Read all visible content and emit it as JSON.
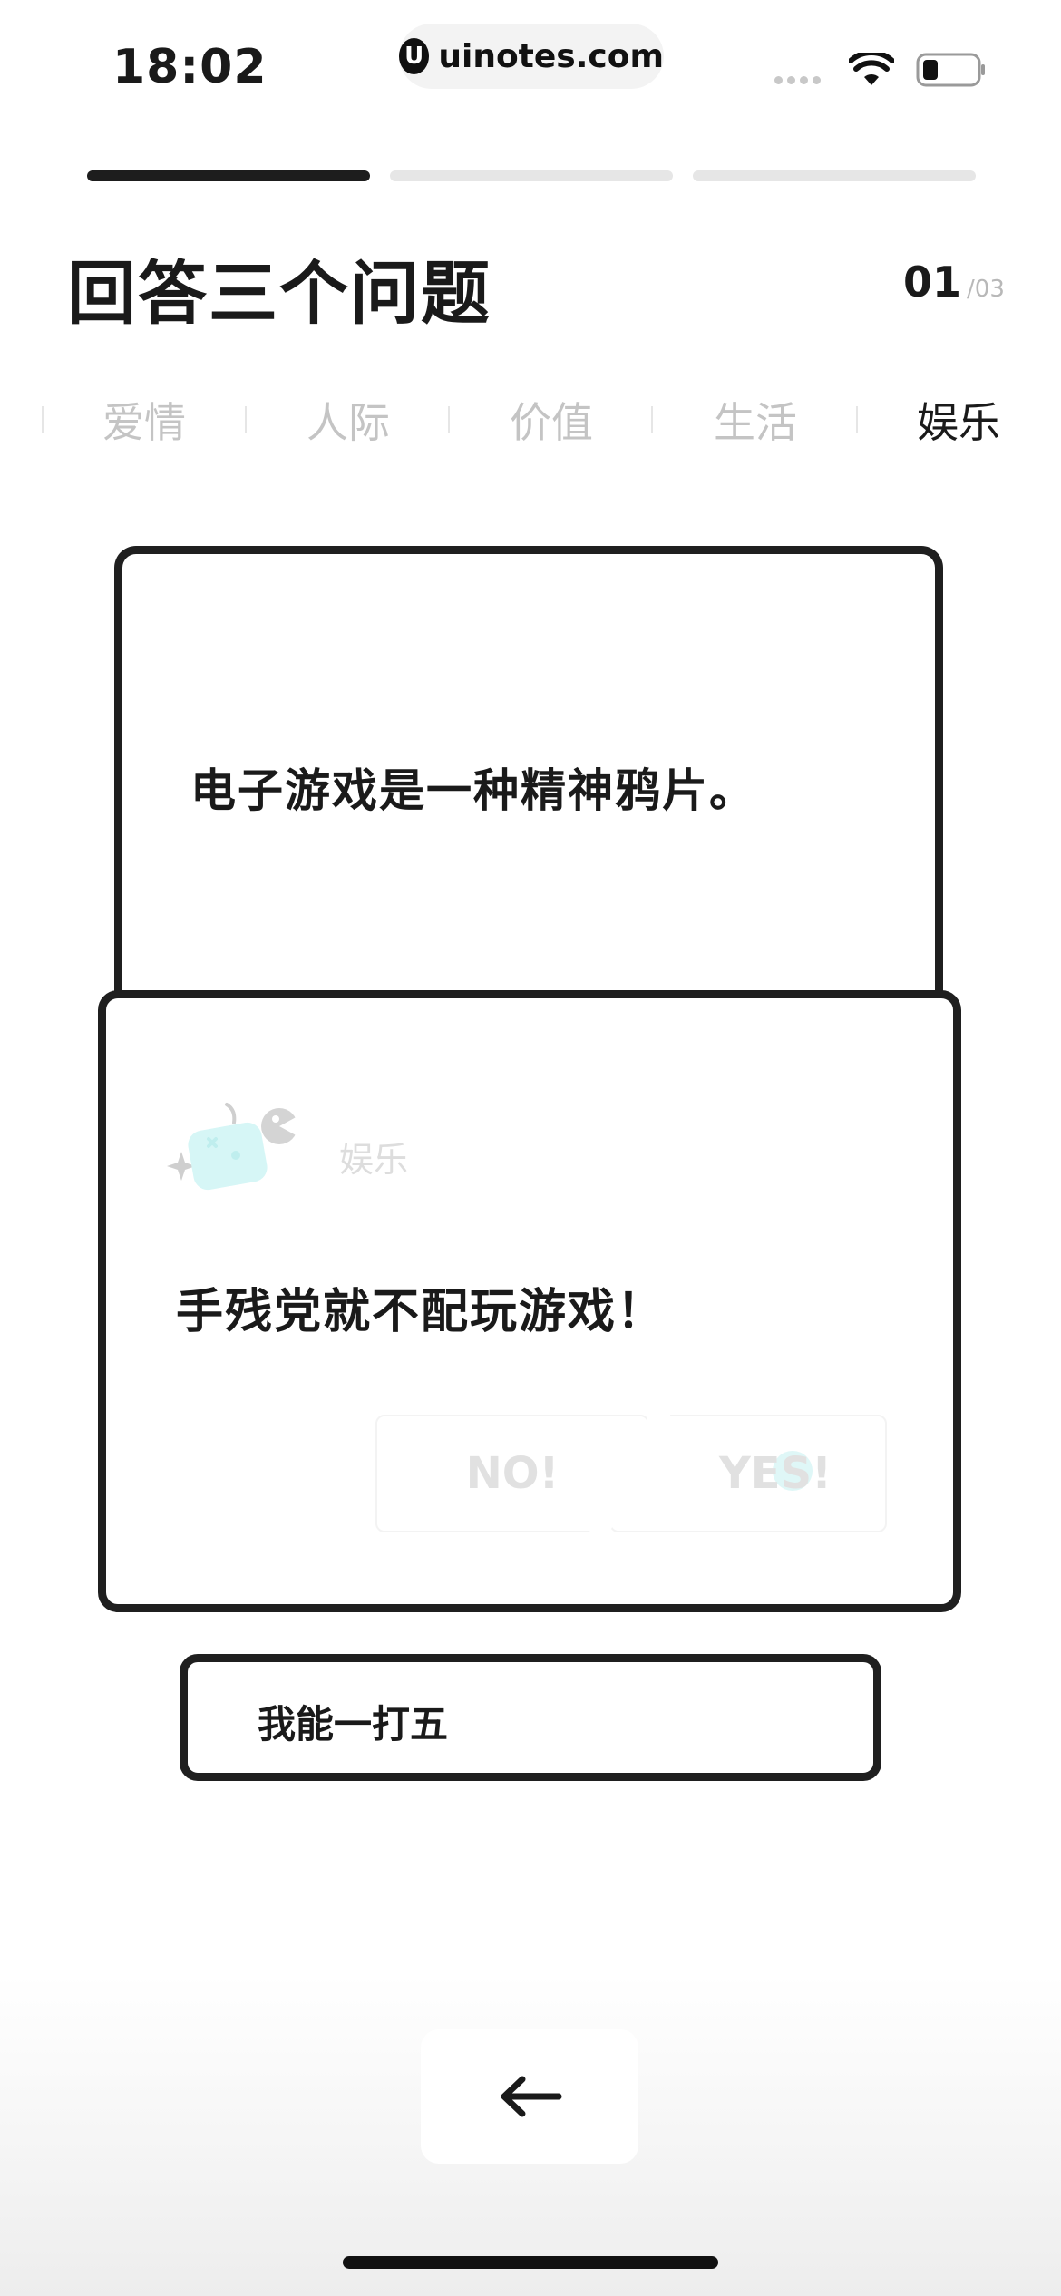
{
  "status_bar": {
    "time": "18:02",
    "url": "uinotes.com",
    "url_logo": "U"
  },
  "progress": {
    "total_steps": 3,
    "active_step": 1
  },
  "header": {
    "title": "回答三个问题",
    "counter_current": "01",
    "counter_total": "/03"
  },
  "tabs": [
    {
      "label": "爱情",
      "active": false
    },
    {
      "label": "人际",
      "active": false
    },
    {
      "label": "价值",
      "active": false
    },
    {
      "label": "生活",
      "active": false
    },
    {
      "label": "娱乐",
      "active": true
    }
  ],
  "back_card": {
    "statement": "电子游戏是一种精神鸦片。"
  },
  "front_card": {
    "category": "娱乐",
    "statement": "手残党就不配玩游戏！",
    "no_label": "NO!",
    "yes_label": "YES!",
    "mascot_icon": "game-controller-mascot-icon"
  },
  "option": {
    "label": "我能一打五"
  },
  "nav": {
    "back_icon": "arrow-left-icon"
  },
  "colors": {
    "primary": "#1a1a1a",
    "muted": "#c4c4c4",
    "mascot": "#d6f6f6",
    "track": "#e6e6e6"
  }
}
